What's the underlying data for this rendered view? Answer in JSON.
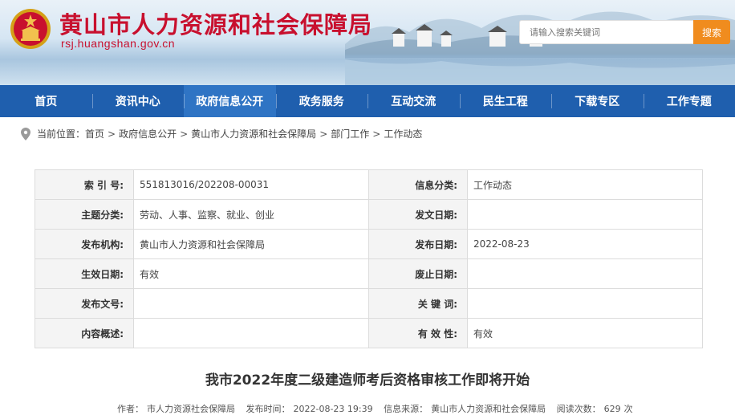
{
  "header": {
    "title": "黄山市人力资源和社会保障局",
    "domain": "rsj.huangshan.gov.cn",
    "search_placeholder": "请输入搜索关键词",
    "search_button": "搜索"
  },
  "nav": [
    "首页",
    "资讯中心",
    "政府信息公开",
    "政务服务",
    "互动交流",
    "民生工程",
    "下载专区",
    "工作专题"
  ],
  "nav_active": 2,
  "breadcrumb": {
    "prefix": "当前位置：",
    "items": [
      "首页",
      "政府信息公开",
      "黄山市人力资源和社会保障局",
      "部门工作",
      "工作动态"
    ],
    "separator": ">"
  },
  "info": {
    "rows": [
      {
        "k1": "索 引 号:",
        "v1": "551813016/202208-00031",
        "k2": "信息分类:",
        "v2": "工作动态"
      },
      {
        "k1": "主题分类:",
        "v1": "劳动、人事、监察、就业、创业",
        "k2": "发文日期:",
        "v2": ""
      },
      {
        "k1": "发布机构:",
        "v1": "黄山市人力资源和社会保障局",
        "k2": "发布日期:",
        "v2": "2022-08-23"
      },
      {
        "k1": "生效日期:",
        "v1": "有效",
        "k2": "废止日期:",
        "v2": ""
      },
      {
        "k1": "发布文号:",
        "v1": "",
        "k2": "关 键 词:",
        "v2": ""
      },
      {
        "k1": "内容概述:",
        "v1": "",
        "k2": "有 效 性:",
        "v2": "有效"
      }
    ]
  },
  "article": {
    "title": "我市2022年度二级建造师考后资格审核工作即将开始",
    "author_label": "作者：",
    "author": "市人力资源社会保障局",
    "time_label": "发布时间：",
    "time": "2022-08-23 19:39",
    "source_label": "信息来源：",
    "source": "黄山市人力资源和社会保障局",
    "views_label": "阅读次数：",
    "views": "629",
    "views_unit": "次"
  },
  "colors": {
    "brand_red": "#c8102e",
    "nav_blue": "#1f5fae",
    "nav_active": "#2f74c4",
    "search_orange": "#f08c1e"
  }
}
